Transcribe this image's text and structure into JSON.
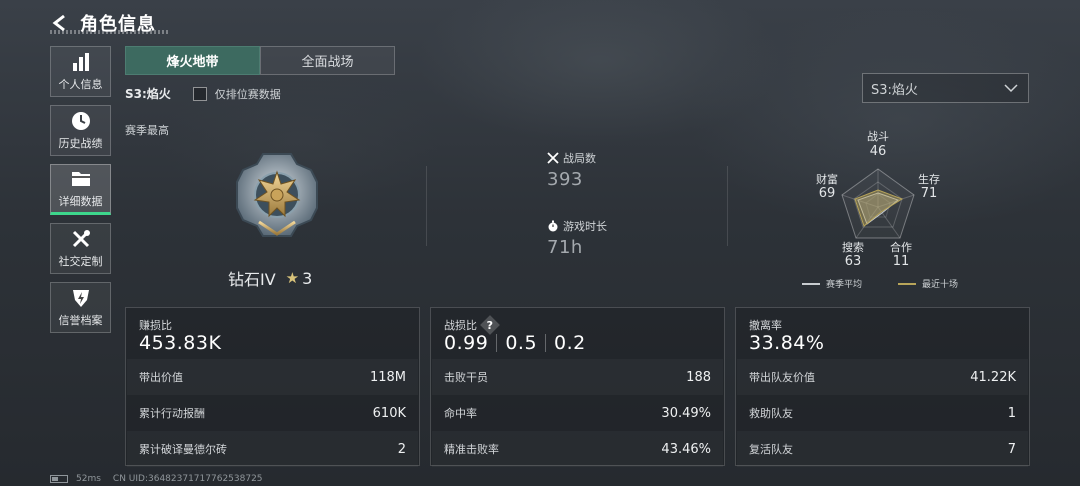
{
  "header": {
    "title": "角色信息"
  },
  "sidebar": {
    "items": [
      {
        "label": "个人信息",
        "icon": "bar-chart-icon"
      },
      {
        "label": "历史战绩",
        "icon": "clock-icon"
      },
      {
        "label": "详细数据",
        "icon": "folder-icon",
        "active": true
      },
      {
        "label": "社交定制",
        "icon": "tools-icon"
      },
      {
        "label": "信誉档案",
        "icon": "shield-bolt-icon"
      }
    ]
  },
  "tabs": [
    {
      "label": "烽火地带",
      "active": true
    },
    {
      "label": "全面战场",
      "active": false
    }
  ],
  "filter": {
    "season": "S3:焰火",
    "ranked_only_label": "仅排位赛数据",
    "ranked_only_checked": false
  },
  "season_select": {
    "value": "S3:焰火"
  },
  "season_best": {
    "label": "赛季最高",
    "rank_name": "钻石IV",
    "stars": "3"
  },
  "center_stats": {
    "matches": {
      "label": "战局数",
      "value": "393"
    },
    "playtime": {
      "label": "游戏时长",
      "value": "71h"
    }
  },
  "radar": {
    "axes": [
      {
        "label": "战斗",
        "value": "46"
      },
      {
        "label": "生存",
        "value": "71"
      },
      {
        "label": "合作",
        "value": "11"
      },
      {
        "label": "搜索",
        "value": "63"
      },
      {
        "label": "财富",
        "value": "69"
      }
    ],
    "legend": [
      {
        "label": "赛季平均",
        "color": "#c8ccd0"
      },
      {
        "label": "最近十场",
        "color": "#b8a55a"
      }
    ]
  },
  "cards": [
    {
      "title": "赚损比",
      "main": "453.83K",
      "rows": [
        {
          "label": "带出价值",
          "value": "118M"
        },
        {
          "label": "累计行动报酬",
          "value": "610K"
        },
        {
          "label": "累计破译曼德尔砖",
          "value": "2"
        }
      ]
    },
    {
      "title": "战损比",
      "main_values": [
        "0.99",
        "0.5",
        "0.2"
      ],
      "rows": [
        {
          "label": "击败干员",
          "value": "188"
        },
        {
          "label": "命中率",
          "value": "30.49%"
        },
        {
          "label": "精准击败率",
          "value": "43.46%"
        }
      ]
    },
    {
      "title": "撤离率",
      "main": "33.84%",
      "rows": [
        {
          "label": "带出队友价值",
          "value": "41.22K"
        },
        {
          "label": "救助队友",
          "value": "1"
        },
        {
          "label": "复活队友",
          "value": "7"
        }
      ]
    }
  ],
  "footer": {
    "ping": "52ms",
    "uid": "CN UID:3648237171776253872​5"
  }
}
